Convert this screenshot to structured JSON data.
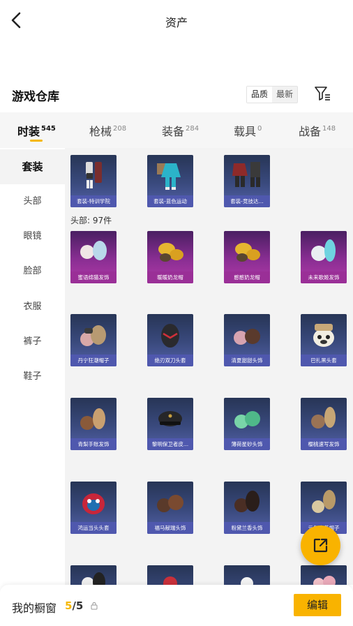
{
  "header": {
    "title": "资产"
  },
  "warehouse": {
    "title": "游戏仓库",
    "sort_options": [
      "品质",
      "最新"
    ],
    "active_sort": "品质"
  },
  "tabs": [
    {
      "label": "时装",
      "count": "545"
    },
    {
      "label": "枪械",
      "count": "208"
    },
    {
      "label": "装备",
      "count": "284"
    },
    {
      "label": "载具",
      "count": "0"
    },
    {
      "label": "战备",
      "count": "148"
    }
  ],
  "sidebar": {
    "items": [
      "套装",
      "头部",
      "眼镜",
      "脸部",
      "衣服",
      "裤子",
      "鞋子"
    ]
  },
  "outfits": [
    {
      "name": "套装-特训学院",
      "icon": "uniform-outfit-icon"
    },
    {
      "name": "套装-蓝色运动",
      "icon": "sport-outfit-icon"
    },
    {
      "name": "套装-竞技达...",
      "icon": "armor-outfit-icon"
    }
  ],
  "head_section": {
    "label": "头部: 97件"
  },
  "head_items": [
    {
      "name": "蜜语绵猫发饰",
      "icon": "hair-icon"
    },
    {
      "name": "暖暖奶龙帽",
      "icon": "hat-icon"
    },
    {
      "name": "憨憨奶龙帽",
      "icon": "hat-icon"
    },
    {
      "name": "未来歌姬发饰",
      "icon": "hair-icon"
    },
    {
      "name": "丹宁狂潮帽子",
      "icon": "hair-icon"
    },
    {
      "name": "绝刃双刀头套",
      "icon": "helmet-icon"
    },
    {
      "name": "清夏甜甜头饰",
      "icon": "hair-icon"
    },
    {
      "name": "巴扎黑头套",
      "icon": "mask-icon"
    },
    {
      "name": "青梨手账发饰",
      "icon": "hair-icon"
    },
    {
      "name": "黎明保卫者皮...",
      "icon": "cap-icon"
    },
    {
      "name": "薄荷星砂头饰",
      "icon": "hair-icon"
    },
    {
      "name": "樱桃速写发饰",
      "icon": "hair-icon"
    },
    {
      "name": "鸿运当头头套",
      "icon": "lion-mask-icon"
    },
    {
      "name": "福马献瑞头饰",
      "icon": "hair-icon"
    },
    {
      "name": "粉黛兰香头饰",
      "icon": "hair-icon"
    },
    {
      "name": "元气小花帽子",
      "icon": "hair-icon"
    }
  ],
  "showcase": {
    "label": "我的橱窗",
    "current": "5",
    "total": "5",
    "edit_label": "编辑"
  },
  "colors": {
    "accent": "#f9b300",
    "card_blue": "#4f58ae",
    "card_purple": "#9a2f97"
  }
}
